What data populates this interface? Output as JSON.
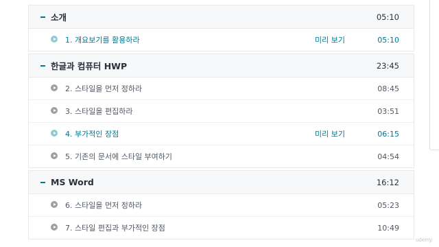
{
  "sections": [
    {
      "title": "소개",
      "duration": "05:10",
      "lectures": [
        {
          "title": "1. 개요보기를 활용하라",
          "preview": "미리 보기",
          "duration": "05:10"
        }
      ]
    },
    {
      "title": "한글과 컴퓨터 HWP",
      "duration": "23:45",
      "lectures": [
        {
          "title": "2. 스타일을 먼저 정하라",
          "preview": "",
          "duration": "08:45"
        },
        {
          "title": "3. 스타일을 편집하라",
          "preview": "",
          "duration": "03:51"
        },
        {
          "title": "4. 부가적인 장점",
          "preview": "미리 보기",
          "duration": "06:15"
        },
        {
          "title": "5. 기존의 문서에 스타일 부여하기",
          "preview": "",
          "duration": "04:54"
        }
      ]
    },
    {
      "title": "MS Word",
      "duration": "16:12",
      "lectures": [
        {
          "title": "6. 스타일을 먼저 정하라",
          "preview": "",
          "duration": "05:23"
        },
        {
          "title": "7. 스타일 편집과 부가적인 장점",
          "preview": "",
          "duration": "10:49"
        }
      ]
    }
  ],
  "watermark": "udemy",
  "colors": {
    "link": "#007791",
    "text": "#29303b",
    "header_bg": "#f7f8fa"
  }
}
